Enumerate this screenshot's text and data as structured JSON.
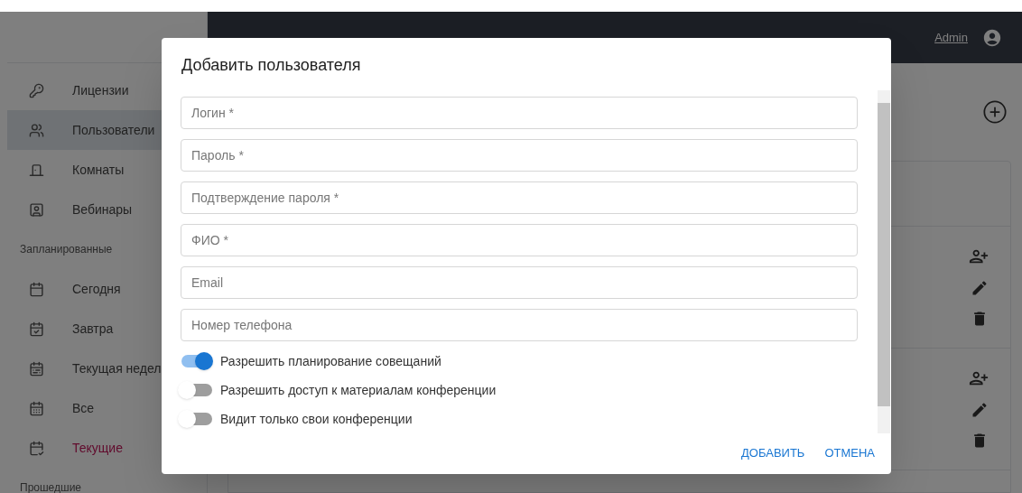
{
  "header": {
    "user_link": "Admin"
  },
  "sidebar": {
    "entries": [
      {
        "kind": "item",
        "label": "Лицензии",
        "selected": false,
        "active": false
      },
      {
        "kind": "item",
        "label": "Пользователи",
        "selected": true,
        "active": false
      },
      {
        "kind": "item",
        "label": "Комнаты",
        "selected": false,
        "active": false
      },
      {
        "kind": "item",
        "label": "Вебинары",
        "selected": false,
        "active": false
      },
      {
        "kind": "section",
        "label": "Запланированные"
      },
      {
        "kind": "item",
        "label": "Сегодня",
        "selected": false,
        "active": false
      },
      {
        "kind": "item",
        "label": "Завтра",
        "selected": false,
        "active": false
      },
      {
        "kind": "item",
        "label": "Текущая недел",
        "selected": false,
        "active": false
      },
      {
        "kind": "item",
        "label": "Все",
        "selected": false,
        "active": false
      },
      {
        "kind": "item",
        "label": "Текущие",
        "selected": false,
        "active": true
      },
      {
        "kind": "section",
        "label": "Прошедшие"
      }
    ]
  },
  "dialog": {
    "title": "Добавить пользователя",
    "fields": [
      {
        "placeholder": "Логин *"
      },
      {
        "placeholder": "Пароль *"
      },
      {
        "placeholder": "Подтверждение пароля *"
      },
      {
        "placeholder": "ФИО *"
      },
      {
        "placeholder": "Email"
      },
      {
        "placeholder": "Номер телефона"
      }
    ],
    "toggles": [
      {
        "label": "Разрешить планирование совещаний",
        "on": true
      },
      {
        "label": "Разрешить доступ к материалам конференции",
        "on": false
      },
      {
        "label": "Видит только свои конференции",
        "on": false
      }
    ],
    "buttons": [
      {
        "label": "ДОБАВИТЬ"
      },
      {
        "label": "ОТМЕНА"
      }
    ]
  }
}
